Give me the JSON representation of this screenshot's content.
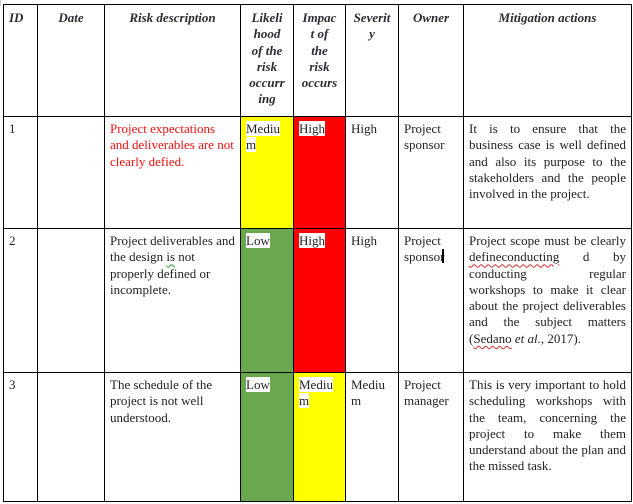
{
  "table": {
    "headers": {
      "id": "ID",
      "date": "Date",
      "risk_description": "Risk description",
      "likelihood": "Likelihood of the risk occurring",
      "impact": "Impact of the risk occurs",
      "severity": "Severity",
      "owner": "Owner",
      "mitigation": "Mitigation actions"
    },
    "header_wrapped": {
      "likelihood": [
        "Likeli",
        "hood",
        "of the",
        "risk",
        "occurr",
        "ing"
      ],
      "impact": [
        "Impac",
        "t of",
        "the",
        "risk",
        "occurs"
      ],
      "severity": [
        "Severit",
        "y"
      ]
    },
    "rows": [
      {
        "id": "1",
        "date": "",
        "risk_description": "Project expectations and deliverables are not clearly defied.",
        "risk_description_color": "#ee1111",
        "likelihood": "Medium",
        "likelihood_wrapped": [
          "Mediu",
          "m"
        ],
        "likelihood_color": "#ffff00",
        "impact": "High",
        "impact_color": "#ff0000",
        "severity": "High",
        "owner": "Project sponsor",
        "mitigation": "It is to ensure that the business case is well defined and also its purpose to the stakeholders and the people involved in the project."
      },
      {
        "id": "2",
        "date": "",
        "risk_description": "Project deliverables and the design is not properly defined or incomplete.",
        "likelihood": "Low",
        "likelihood_color": "#6aa84f",
        "impact": "High",
        "impact_color": "#ff0000",
        "severity": "High",
        "owner": "Project sponsor",
        "mitigation_parts": {
          "before": "Project scope must be clearly ",
          "misspelled": "defineconducting",
          "middle": " d by conducting regular workshops to make it clear about the project deliverables and the subject matters (",
          "citation_author": "Sedano",
          "citation_etal": "et al.",
          "citation_year": ", 2017)."
        }
      },
      {
        "id": "3",
        "date": "",
        "risk_description": "The schedule of the project is not well understood.",
        "likelihood": "Low",
        "likelihood_color": "#6aa84f",
        "impact": "Medium",
        "impact_wrapped": [
          "Mediu",
          "m"
        ],
        "impact_color": "#ffff00",
        "severity": "Medium",
        "severity_wrapped": [
          "Mediu",
          "m"
        ],
        "owner": "Project manager",
        "mitigation": "This is very important to hold scheduling workshops with the team, concerning the project to make them understand about the plan and the missed task."
      }
    ]
  }
}
